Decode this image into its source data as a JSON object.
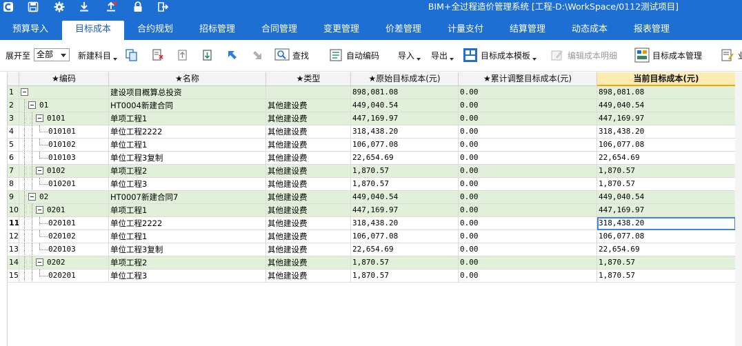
{
  "app": {
    "title": "BIM+全过程造价管理系统 [工程-D:\\WorkSpace/0112测试项目]",
    "title_icons": [
      "app-logo-icon",
      "save-icon",
      "gear-icon",
      "download-icon",
      "upload-icon",
      "lock-icon",
      "exit-icon"
    ]
  },
  "tabs": [
    {
      "label": "预算导入",
      "active": false
    },
    {
      "label": "目标成本",
      "active": true
    },
    {
      "label": "合约规划",
      "active": false
    },
    {
      "label": "招标管理",
      "active": false
    },
    {
      "label": "合同管理",
      "active": false
    },
    {
      "label": "变更管理",
      "active": false
    },
    {
      "label": "价差管理",
      "active": false
    },
    {
      "label": "计量支付",
      "active": false
    },
    {
      "label": "结算管理",
      "active": false
    },
    {
      "label": "动态成本",
      "active": false
    },
    {
      "label": "报表管理",
      "active": false
    }
  ],
  "toolbar": {
    "expand_label": "展开至",
    "expand_value": "全部",
    "new_subject": "新建科目",
    "find": "查找",
    "auto_code": "自动编码",
    "import": "导入",
    "export": "导出",
    "template": "目标成本模板",
    "edit_detail": "编辑成本明细",
    "manage": "目标成本管理",
    "last_partial": "业"
  },
  "table": {
    "headers": [
      "★编码",
      "★名称",
      "★类型",
      "★原始目标成本(元)",
      "★累计调整目标成本(元)",
      "当前目标成本(元)"
    ],
    "rows": [
      {
        "n": "1",
        "code": "",
        "name": "建设项目概算总投资",
        "type": "",
        "orig": "898,081.08",
        "adj": "0.00",
        "cur": "898,081.08",
        "level": 0,
        "group": true
      },
      {
        "n": "2",
        "code": "01",
        "name": "HT0004新建合同",
        "type": "其他建设费",
        "orig": "449,040.54",
        "adj": "0.00",
        "cur": "449,040.54",
        "level": 1,
        "group": true
      },
      {
        "n": "3",
        "code": "0101",
        "name": "单项工程1",
        "type": "其他建设费",
        "orig": "447,169.97",
        "adj": "0.00",
        "cur": "447,169.97",
        "level": 2,
        "group": true
      },
      {
        "n": "4",
        "code": "010101",
        "name": "单位工程2222",
        "type": "其他建设费",
        "orig": "318,438.20",
        "adj": "0.00",
        "cur": "318,438.20",
        "level": 3,
        "group": false
      },
      {
        "n": "5",
        "code": "010102",
        "name": "单位工程1",
        "type": "其他建设费",
        "orig": "106,077.08",
        "adj": "0.00",
        "cur": "106,077.08",
        "level": 3,
        "group": false
      },
      {
        "n": "6",
        "code": "010103",
        "name": "单位工程3复制",
        "type": "其他建设费",
        "orig": "22,654.69",
        "adj": "0.00",
        "cur": "22,654.69",
        "level": 3,
        "group": false
      },
      {
        "n": "7",
        "code": "0102",
        "name": "单项工程2",
        "type": "其他建设费",
        "orig": "1,870.57",
        "adj": "0.00",
        "cur": "1,870.57",
        "level": 2,
        "group": true
      },
      {
        "n": "8",
        "code": "010201",
        "name": "单位工程3",
        "type": "其他建设费",
        "orig": "1,870.57",
        "adj": "0.00",
        "cur": "1,870.57",
        "level": 3,
        "group": false
      },
      {
        "n": "9",
        "code": "02",
        "name": "HT0007新建合同7",
        "type": "其他建设费",
        "orig": "449,040.54",
        "adj": "0.00",
        "cur": "449,040.54",
        "level": 1,
        "group": true
      },
      {
        "n": "10",
        "code": "0201",
        "name": "单项工程1",
        "type": "其他建设费",
        "orig": "447,169.97",
        "adj": "0.00",
        "cur": "447,169.97",
        "level": 2,
        "group": true
      },
      {
        "n": "11",
        "code": "020101",
        "name": "单位工程2222",
        "type": "其他建设费",
        "orig": "318,438.20",
        "adj": "0.00",
        "cur": "318,438.20",
        "level": 3,
        "group": false,
        "selected": true
      },
      {
        "n": "12",
        "code": "020102",
        "name": "单位工程1",
        "type": "其他建设费",
        "orig": "106,077.08",
        "adj": "0.00",
        "cur": "106,077.08",
        "level": 3,
        "group": false
      },
      {
        "n": "13",
        "code": "020103",
        "name": "单位工程3复制",
        "type": "其他建设费",
        "orig": "22,654.69",
        "adj": "0.00",
        "cur": "22,654.69",
        "level": 3,
        "group": false
      },
      {
        "n": "14",
        "code": "0202",
        "name": "单项工程2",
        "type": "其他建设费",
        "orig": "1,870.57",
        "adj": "0.00",
        "cur": "1,870.57",
        "level": 2,
        "group": true
      },
      {
        "n": "15",
        "code": "020201",
        "name": "单位工程3",
        "type": "其他建设费",
        "orig": "1,870.57",
        "adj": "0.00",
        "cur": "1,870.57",
        "level": 3,
        "group": false
      }
    ]
  },
  "colors": {
    "brand": "#1e6fd4",
    "group_row": "#e2f0d9",
    "current_header": "#fdebb2",
    "selection": "#3f86d6"
  }
}
